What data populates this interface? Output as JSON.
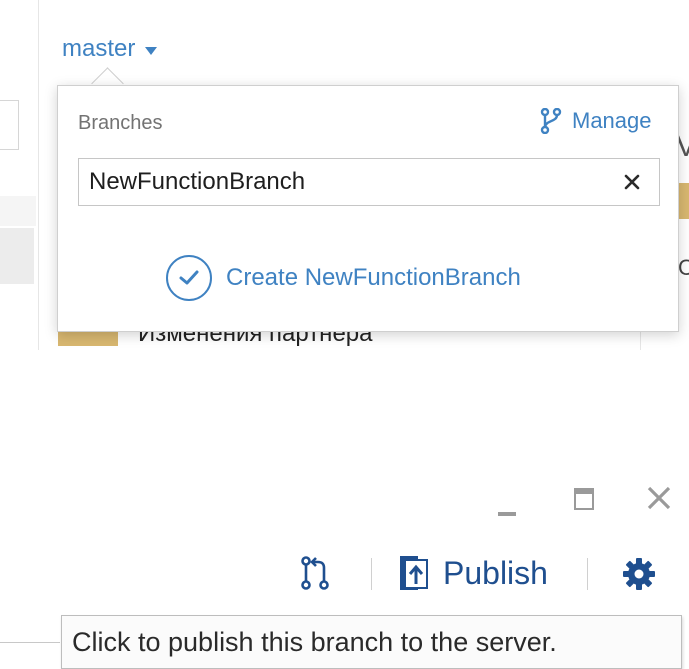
{
  "branch_selector": {
    "current_branch": "master"
  },
  "branch_popup": {
    "title": "Branches",
    "manage_label": "Manage",
    "search_value": "NewFunctionBranch",
    "search_placeholder": "",
    "create_label": "Create NewFunctionBranch"
  },
  "background": {
    "row_label": "Изменения партнера",
    "right_glyph": "V",
    "right_char": "Co"
  },
  "toolbar": {
    "publish_label": "Publish"
  },
  "tooltip": {
    "text": "Click to publish this branch to the server."
  },
  "icons": {
    "branch": "branch-icon",
    "clear": "close-icon",
    "check": "checkmark-icon",
    "pull_request": "pull-request-icon",
    "publish": "publish-icon",
    "settings": "gear-icon",
    "minimize": "minimize-icon",
    "maximize": "maximize-icon",
    "close": "close-icon"
  },
  "colors": {
    "accent": "#3f82c2",
    "toolbar_icon": "#1f4f8f",
    "muted": "#9a9a9a"
  }
}
